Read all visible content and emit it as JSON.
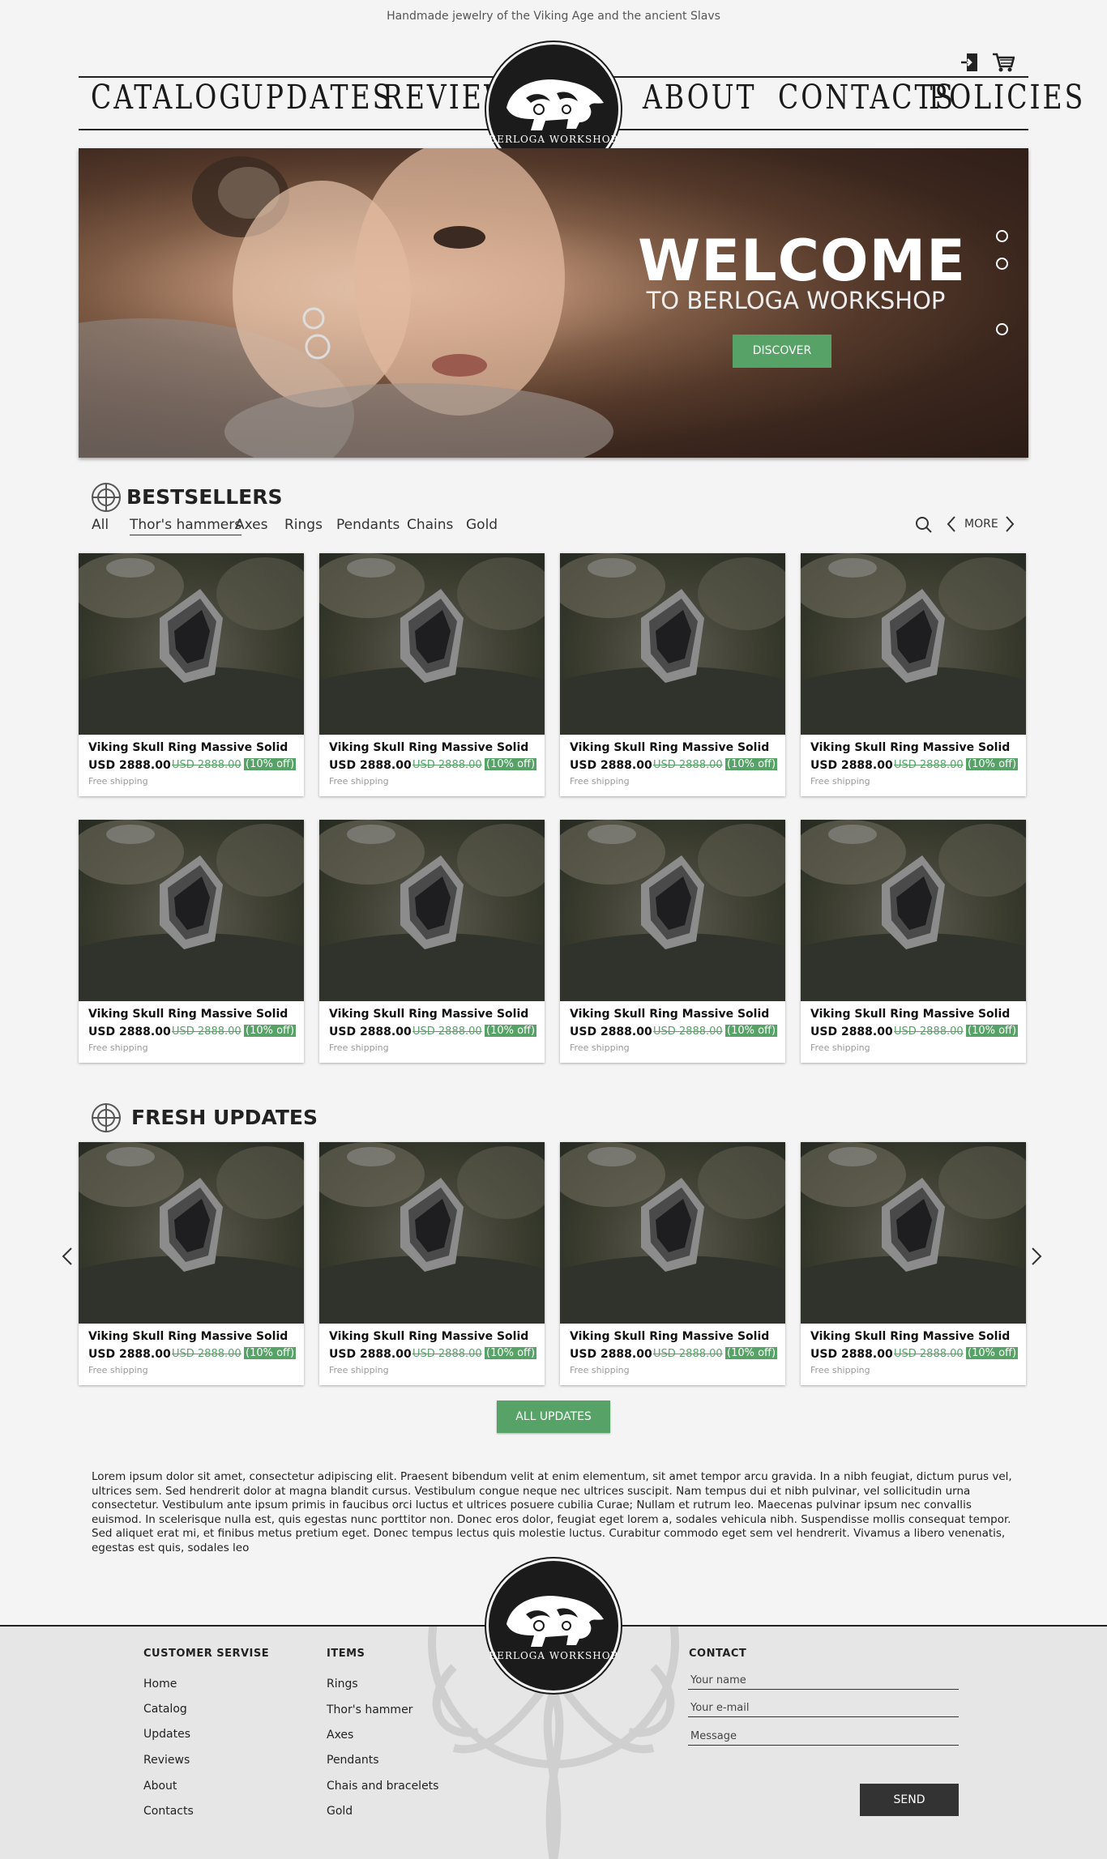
{
  "header": {
    "tagline": "Handmade jewelry of the Viking Age and the ancient Slavs",
    "nav_left": [
      "CATALOG",
      "UPDATES",
      "REVIEWS"
    ],
    "nav_right": [
      "ABOUT",
      "CONTACTS",
      "POLICIES"
    ],
    "logo_text": "BERLOGA WORKSHOP",
    "icons": [
      "login-icon",
      "cart-icon"
    ]
  },
  "hero": {
    "title": "WELCOME",
    "subtitle": "TO BERLOGA WORKSHOP",
    "button": "DISCOVER",
    "slides": 3
  },
  "bestsellers": {
    "title": "BESTSELLERS",
    "tabs": [
      "All",
      "Thor's hammers",
      "Axes",
      "Rings",
      "Pendants",
      "Chains",
      "Gold"
    ],
    "active_tab": "Thor's hammers",
    "more_label": "MORE"
  },
  "product": {
    "title": "Viking Skull Ring Massive Solid",
    "price": "USD 2888.00",
    "old_price": "USD 2888.00",
    "discount": "(10% off)",
    "shipping": "Free shipping"
  },
  "fresh": {
    "title": "FRESH UPDATES",
    "button": "ALL UPDATES"
  },
  "lorem": "Lorem ipsum dolor sit amet, consectetur adipiscing elit. Praesent bibendum velit at enim elementum, sit amet tempor arcu gravida. In a nibh feugiat, dictum purus vel, ultrices sem. Sed hendrerit dolor at magna blandit cursus. Vestibulum congue neque nec ultrices suscipit. Nam tempus dui et nibh pulvinar, vel sollicitudin urna consectetur. Vestibulum ante ipsum primis in faucibus orci luctus et ultrices posuere cubilia Curae; Nullam et rutrum leo. Maecenas pulvinar ipsum nec convallis euismod. In scelerisque nulla est, quis egestas nunc porttitor non. Donec eros dolor, feugiat eget lorem a, sodales vehicula nibh. Suspendisse mollis consequat tempor. Sed aliquet erat mi, et finibus metus pretium eget. Donec tempus lectus quis molestie luctus. Curabitur commodo eget sem vel hendrerit. Vivamus a libero venenatis, egestas est quis, sodales leo",
  "footer": {
    "customer_title": "CUSTOMER SERVISE",
    "customer_links": [
      "Home",
      "Catalog",
      "Updates",
      "Reviews",
      "About",
      "Contacts"
    ],
    "items_title": "ITEMS",
    "items_links": [
      "Rings",
      "Thor's hammer",
      "Axes",
      "Pendants",
      "Chais and bracelets",
      "Gold"
    ],
    "contact_title": "CONTACT",
    "name_placeholder": "Your name",
    "email_placeholder": "Your e-mail",
    "message_placeholder": "Message",
    "send": "SEND"
  },
  "colors": {
    "accent": "#57a266",
    "dark": "#1b1b1b",
    "background": "#f4f4f4"
  }
}
